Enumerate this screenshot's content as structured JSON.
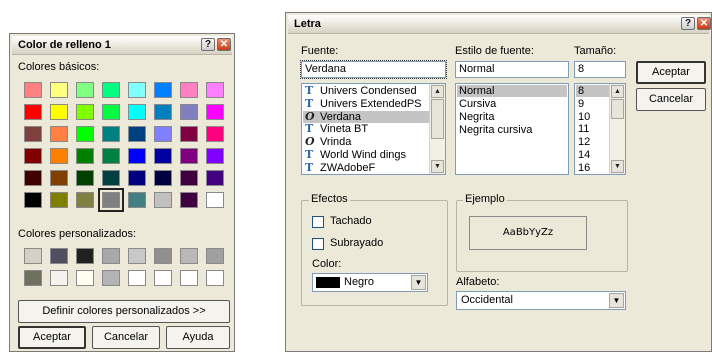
{
  "color_dialog": {
    "title": "Color de relleno 1",
    "help_icon": "?",
    "close_icon": "✕",
    "basic_label": "Colores básicos:",
    "custom_label": "Colores personalizados:",
    "define_button": "Definir colores personalizados >>",
    "accept_button": "Aceptar",
    "cancel_button": "Cancelar",
    "help_button": "Ayuda",
    "basic_colors": [
      [
        "#ff8080",
        "#ffff80",
        "#80ff80",
        "#00ff80",
        "#80ffff",
        "#0080ff",
        "#ff80c0",
        "#ff80ff"
      ],
      [
        "#ff0000",
        "#ffff00",
        "#80ff00",
        "#00ff40",
        "#00ffff",
        "#0080c0",
        "#8080c0",
        "#ff00ff"
      ],
      [
        "#804040",
        "#ff8040",
        "#00ff00",
        "#008080",
        "#004080",
        "#8080ff",
        "#800040",
        "#ff0080"
      ],
      [
        "#800000",
        "#ff8000",
        "#008000",
        "#008040",
        "#0000ff",
        "#0000a0",
        "#800080",
        "#8000ff"
      ],
      [
        "#400000",
        "#804000",
        "#004000",
        "#004040",
        "#000080",
        "#000040",
        "#400040",
        "#400080"
      ],
      [
        "#000000",
        "#808000",
        "#808040",
        "#808080",
        "#408080",
        "#c0c0c0",
        "#400040",
        "#ffffff"
      ]
    ],
    "selected_index": [
      5,
      3
    ],
    "custom_colors": [
      [
        "#d4d0c8",
        "#4f4f5f",
        "#202020",
        "#a8a8a8",
        "#c8c8c8",
        "#909090",
        "#b8b8b8",
        "#a0a0a0"
      ],
      [
        "#707060",
        "#f4f2ee",
        "#fffff0",
        "#b4b4b4",
        "#ffffff",
        "#ffffff",
        "#ffffff",
        "#ffffff"
      ]
    ]
  },
  "font_dialog": {
    "title": "Letra",
    "help_icon": "?",
    "close_icon": "✕",
    "font_label": "Fuente:",
    "font_value": "Verdana",
    "style_label": "Estilo de fuente:",
    "style_value": "Normal",
    "size_label": "Tamaño:",
    "size_value": "8",
    "accept_button": "Aceptar",
    "cancel_button": "Cancelar",
    "fonts": [
      {
        "icon": "T",
        "name": "Univers Condensed"
      },
      {
        "icon": "T",
        "name": "Univers ExtendedPS"
      },
      {
        "icon": "O",
        "name": "Verdana"
      },
      {
        "icon": "T",
        "name": "Vineta BT"
      },
      {
        "icon": "O",
        "name": "Vrinda"
      },
      {
        "icon": "T",
        "name": "World Wind dings"
      },
      {
        "icon": "T",
        "name": "ZWAdobeF"
      }
    ],
    "selected_font": 2,
    "styles": [
      "Normal",
      "Cursiva",
      "Negrita",
      "Negrita cursiva"
    ],
    "selected_style": 0,
    "sizes": [
      "8",
      "9",
      "10",
      "11",
      "12",
      "14",
      "16"
    ],
    "selected_size": 0,
    "effects_label": "Efectos",
    "strike_label": "Tachado",
    "underline_label": "Subrayado",
    "color_label": "Color:",
    "color_value": "Negro",
    "color_swatch": "#000000",
    "sample_label": "Ejemplo",
    "sample_text": "AaBbYyZz",
    "script_label": "Alfabeto:",
    "script_value": "Occidental"
  }
}
